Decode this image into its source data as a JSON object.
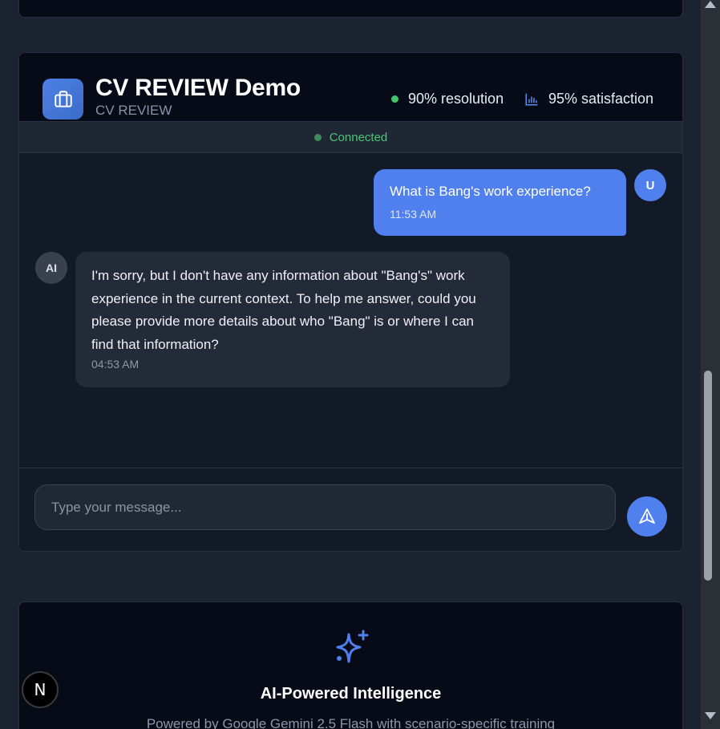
{
  "chat": {
    "title": "CV REVIEW Demo",
    "subtitle": "CV REVIEW",
    "stats": {
      "resolution": "90% resolution",
      "satisfaction": "95% satisfaction"
    },
    "status": "Connected",
    "messages": {
      "user": {
        "avatar": "U",
        "text": "What is Bang's work experience?",
        "time": "11:53 AM"
      },
      "ai": {
        "avatar": "AI",
        "text": "I'm sorry, but I don't have any information about \"Bang's\" work experience in the current context. To help me answer, could you please provide more details about who \"Bang\" is or where I can find that information?",
        "time": "04:53 AM"
      }
    },
    "input": {
      "placeholder": "Type your message...",
      "value": ""
    }
  },
  "feature": {
    "title": "AI-Powered Intelligence",
    "description": "Powered by Google Gemini 2.5 Flash with scenario-specific training"
  },
  "badge": {
    "letter": "N"
  },
  "colors": {
    "accent": "#4f80ee",
    "status_green": "#43c36b",
    "background": "#1b2230",
    "card": "#131a27"
  },
  "icons": {
    "brand": "briefcase-icon",
    "satisfaction": "bar-chart-icon",
    "send": "send-icon",
    "feature": "sparkles-icon"
  }
}
